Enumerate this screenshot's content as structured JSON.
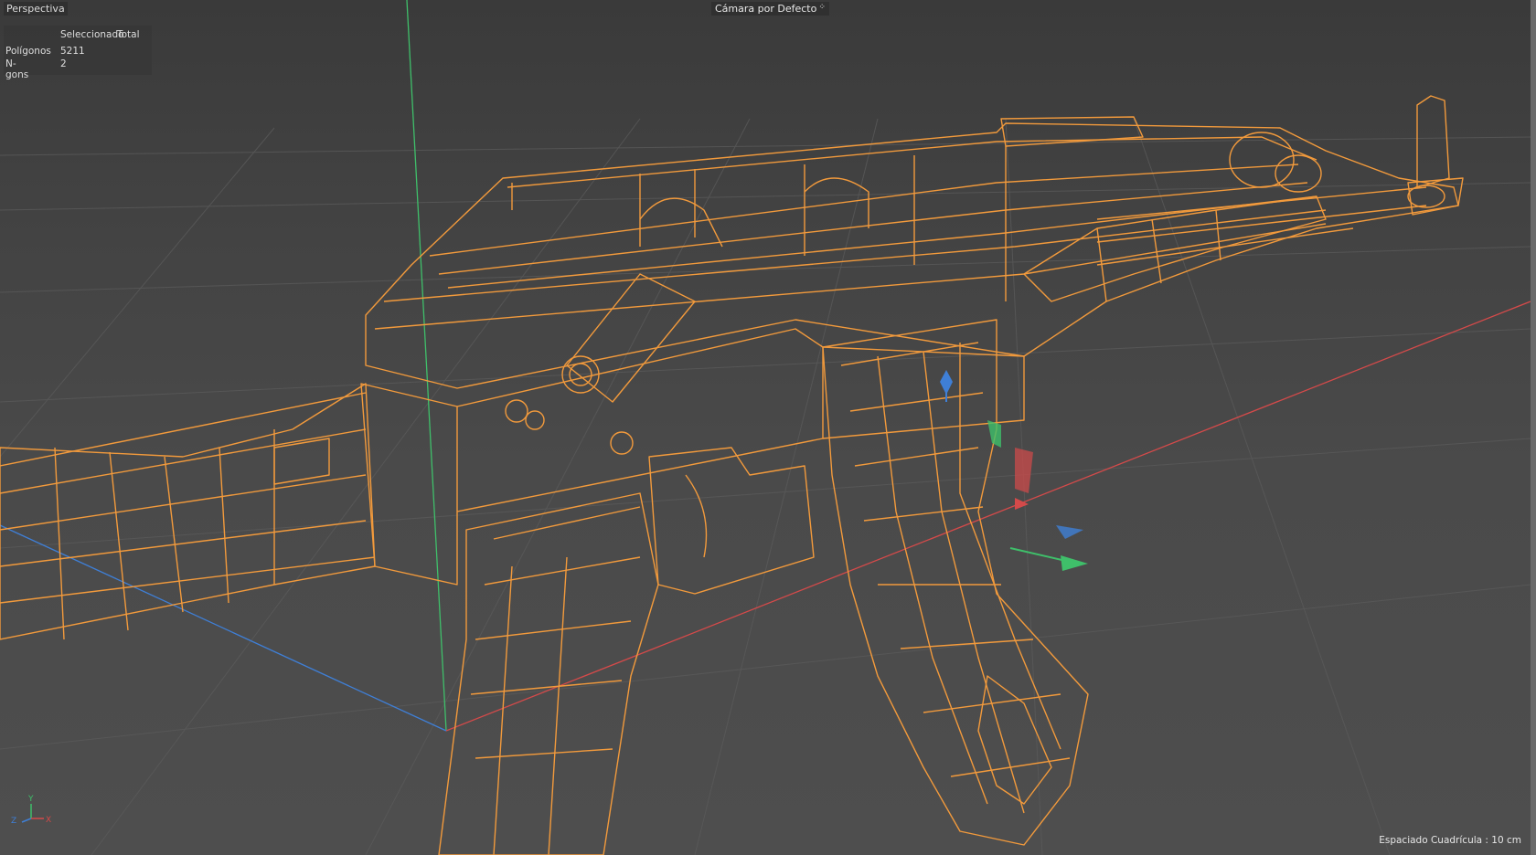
{
  "viewport": {
    "name": "Perspectiva",
    "camera": "Cámara por Defecto",
    "camera_icon": "camera-icon"
  },
  "stats": {
    "headers": [
      "Seleccionado",
      "Total"
    ],
    "rows": [
      {
        "label": "Polígonos",
        "selected": "5211",
        "total": ""
      },
      {
        "label": "N-gons",
        "selected": "2",
        "total": ""
      }
    ]
  },
  "footer": {
    "grid_spacing": "Espaciado Cuadrícula : 10 cm"
  },
  "gizmo": {
    "labels": [
      "Y",
      "Z",
      "X"
    ]
  },
  "colors": {
    "wireframe": "#f29a3c",
    "axis_x": "#d44a4a",
    "axis_y": "#3fbf6a",
    "axis_z": "#3f7fd6",
    "background": "#4b4b4b"
  },
  "icons": [
    "camera-icon",
    "axis-gizmo-icon",
    "move-manipulator-icon"
  ]
}
